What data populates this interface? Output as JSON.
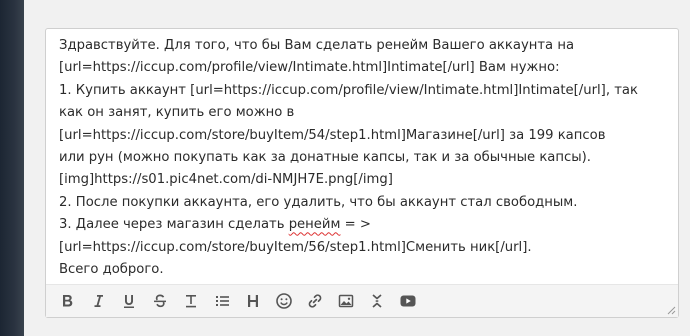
{
  "message": {
    "line1": "Здравствуйте. Для того, что бы Вам сделать ренейм Вашего аккаунта на",
    "line2": "[url=https://iccup.com/profile/view/Intimate.html]Intimate[/url] Вам нужно:",
    "line3": "1. Купить аккаунт [url=https://iccup.com/profile/view/Intimate.html]Intimate[/url], так",
    "line4": "как он занят, купить его можно в",
    "line5": "[url=https://iccup.com/store/buyItem/54/step1.html]Магазине[/url] за 199 капсов",
    "line6": "или рун (можно покупать как за донатные капсы, так и за обычные капсы).",
    "line7": "[img]https://s01.pic4net.com/di-NMJH7E.png[/img]",
    "line8": "2. После покупки аккаунта, его удалить, что бы аккаунт стал свободным.",
    "line9_before": "3. Далее через магазин сделать ",
    "line9_misspelled": "ренейм",
    "line9_after": " = >",
    "line10": "[url=https://iccup.com/store/buyItem/56/step1.html]Сменить ник[/url].",
    "line11": "Всего доброго."
  },
  "toolbar": {
    "buttons": [
      {
        "icon": "bold-icon"
      },
      {
        "icon": "italic-icon"
      },
      {
        "icon": "underline-icon"
      },
      {
        "icon": "strikethrough-icon"
      },
      {
        "icon": "clear-format-icon"
      },
      {
        "icon": "list-icon"
      },
      {
        "icon": "heading-icon"
      },
      {
        "icon": "emoji-icon"
      },
      {
        "icon": "link-icon"
      },
      {
        "icon": "image-icon"
      },
      {
        "icon": "spoiler-icon"
      },
      {
        "icon": "video-icon"
      }
    ]
  },
  "colors": {
    "text": "#2b2b2b",
    "icon": "#555555",
    "toolbar_bg": "#f4f4f4",
    "misspell_underline": "#dd3333"
  }
}
